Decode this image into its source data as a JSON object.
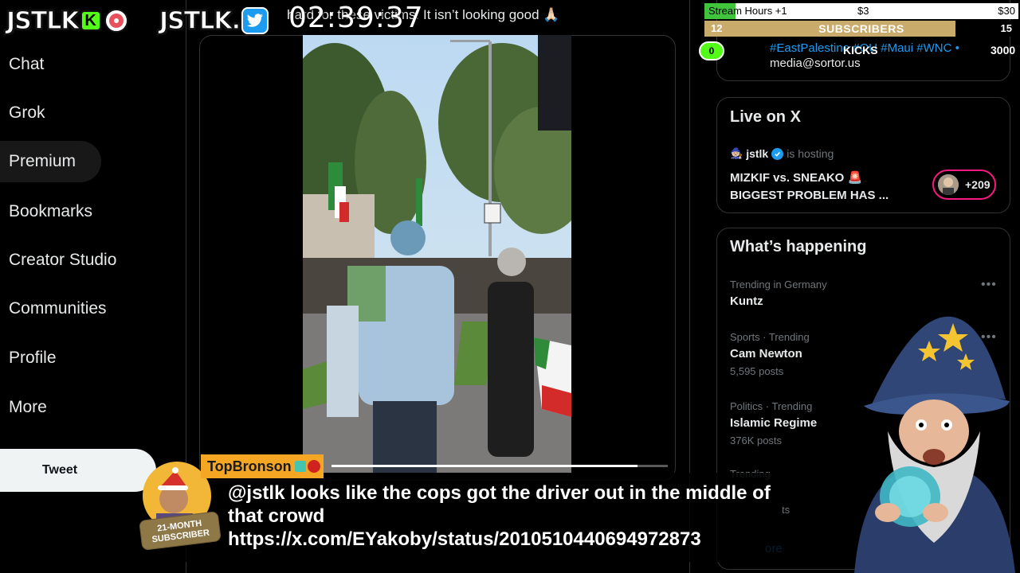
{
  "nav": {
    "items": [
      {
        "label": "Chat"
      },
      {
        "label": "Grok"
      },
      {
        "label": "Premium"
      },
      {
        "label": "Bookmarks"
      },
      {
        "label": "Creator Studio"
      },
      {
        "label": "Communities"
      },
      {
        "label": "Profile"
      },
      {
        "label": "More"
      }
    ],
    "tweet_button": "Tweet"
  },
  "overlay": {
    "logo_left": "JSTLK",
    "logo_k": "K",
    "logo_right": "JSTLK.",
    "timer": "02:39:37",
    "post_text_fragment": "hard for these victims. It isn’t looking good 🙏🏻"
  },
  "video": {
    "progress": 0.91
  },
  "stream_goal": {
    "label": "Stream Hours +1",
    "mid": "$3",
    "target": "$30",
    "progress": 0.1
  },
  "subs_goal": {
    "current": "12",
    "label": "SUBSCRIBERS",
    "target": "15",
    "progress": 0.8
  },
  "kicks_goal": {
    "current": "0",
    "label": "KICKS",
    "target": "3000"
  },
  "right": {
    "top_card": {
      "hashtags": "#EastPalestine #OU #Maui #WNC •",
      "email": "media@sortor.us"
    },
    "live": {
      "title": "Live on X",
      "host": "jstlk",
      "hosting": "is hosting",
      "space_title": "MIZKIF vs. SNEAKO 🚨 BIGGEST PROBLEM HAS ...",
      "listeners": "+209"
    },
    "happening": {
      "title": "What’s happening",
      "trends": [
        {
          "meta": "Trending in Germany",
          "name": "Kuntz",
          "posts": ""
        },
        {
          "meta": "Sports · Trending",
          "name": "Cam Newton",
          "posts": "5,595 posts"
        },
        {
          "meta": "Politics · Trending",
          "name": "Islamic Regime",
          "posts": "376K posts"
        }
      ],
      "partial_trend_meta": "Trending",
      "partial_posts": "ts",
      "show_more": "ore"
    }
  },
  "chat": {
    "username": "TopBronson",
    "badge_text": "21-MONTH SUBSCRIBER",
    "message": "@jstlk looks like the cops got the driver out in the middle of that crowd https://x.com/EYakoby/status/2010510440694972873"
  },
  "colors": {
    "accent": "#1d9bf0",
    "kick_green": "#53fc18",
    "goal_green": "#3fc43b",
    "subs_gold": "#c9ab6b",
    "chat_user_bg": "#f5a623",
    "live_ring": "#f91880"
  },
  "icons": {
    "twitter": "twitter-bird-icon",
    "record": "record-icon",
    "verified": "verified-badge-icon",
    "more": "more-dots-icon"
  }
}
